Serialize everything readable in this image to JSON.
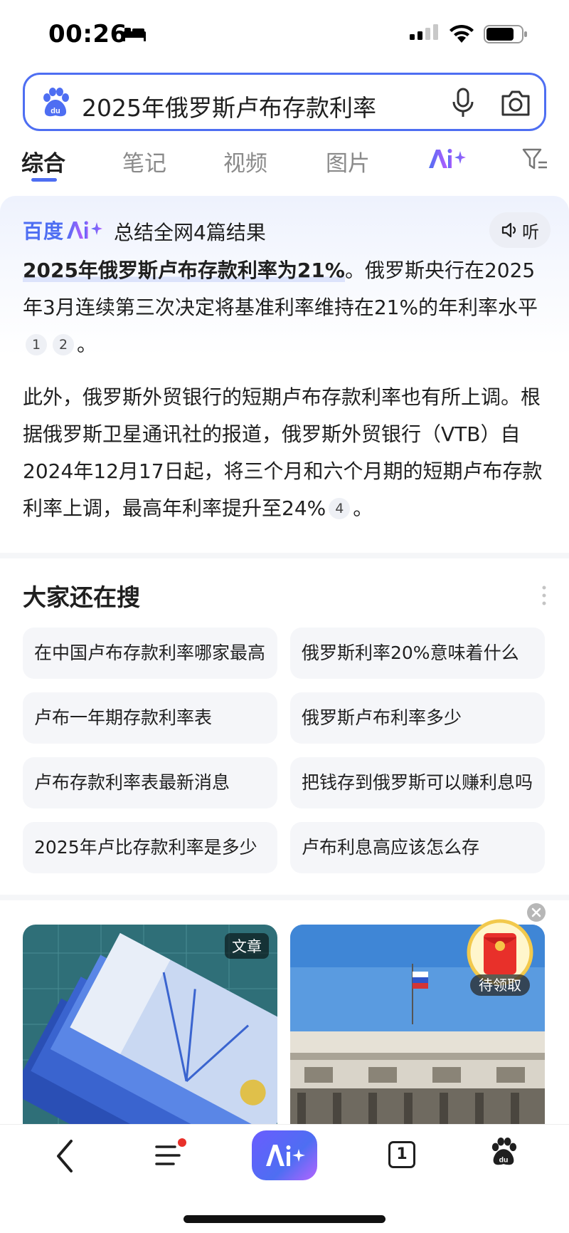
{
  "status_bar": {
    "time": "00:26"
  },
  "search": {
    "query": "2025年俄罗斯卢布存款利率"
  },
  "tabs": [
    {
      "label": "综合",
      "active": true
    },
    {
      "label": "笔记"
    },
    {
      "label": "视频"
    },
    {
      "label": "图片"
    }
  ],
  "ai_summary": {
    "brand": "百度",
    "result_count": "总结全网4篇结果",
    "listen_label": "听",
    "para1_highlight": "2025年俄罗斯卢布存款利率为21%",
    "para1_rest": "。俄罗斯央行在2025年3月连续第三次决定将基准利率维持在21%的年利率水平",
    "para1_end": "。",
    "para1_cites": [
      "1",
      "2"
    ],
    "para2_text": "此外，俄罗斯外贸银行的短期卢布存款利率也有所上调。根据俄罗斯卫星通讯社的报道，俄罗斯外贸银行（VTB）自2024年12月17日起，将三个月和六个月期的短期卢布存款利率上调，最高年利率提升至24%",
    "para2_end": "。",
    "para2_cite": "4"
  },
  "related": {
    "title": "大家还在搜",
    "items": [
      "在中国卢布存款利率哪家最高",
      "俄罗斯利率20%意味着什么",
      "卢布一年期存款利率表",
      "俄罗斯卢布利率多少",
      "卢布存款利率表最新消息",
      "把钱存到俄罗斯可以赚利息吗",
      "2025年卢比存款利率是多少",
      "卢布利息高应该怎么存"
    ]
  },
  "image_cards": {
    "badge": "文章",
    "red_packet_label": "待领取"
  },
  "bottom_nav": {
    "tab_count": "1"
  },
  "colors": {
    "accent": "#4e6ef2",
    "card_bg": "#f5f6f9",
    "text": "#1f1f1f"
  }
}
